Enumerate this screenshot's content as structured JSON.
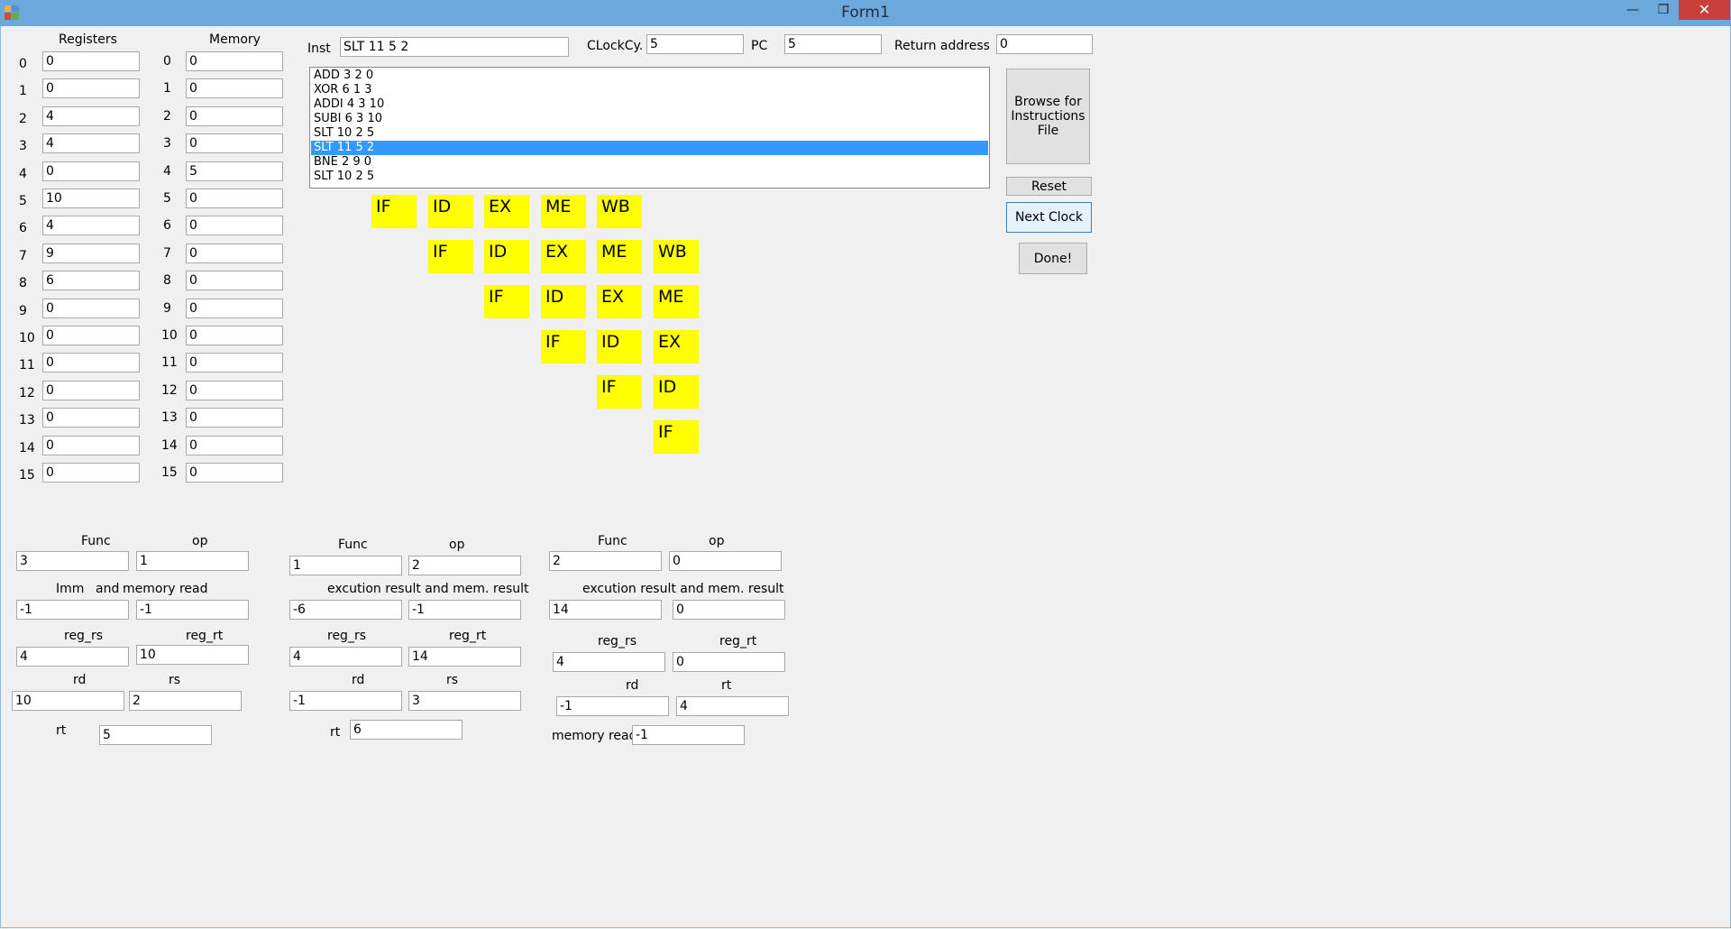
{
  "window": {
    "title": "Form1",
    "min": "—",
    "max": "❐",
    "close": "✕"
  },
  "registers": {
    "title": "Registers",
    "items": [
      {
        "label": "0",
        "value": "0"
      },
      {
        "label": "1",
        "value": "0"
      },
      {
        "label": "2",
        "value": "4"
      },
      {
        "label": "3",
        "value": "4"
      },
      {
        "label": "4",
        "value": "0"
      },
      {
        "label": "5",
        "value": "10"
      },
      {
        "label": "6",
        "value": "4"
      },
      {
        "label": "7",
        "value": "9"
      },
      {
        "label": "8",
        "value": "6"
      },
      {
        "label": "9",
        "value": "0"
      },
      {
        "label": "10",
        "value": "0"
      },
      {
        "label": "11",
        "value": "0"
      },
      {
        "label": "12",
        "value": "0"
      },
      {
        "label": "13",
        "value": "0"
      },
      {
        "label": "14",
        "value": "0"
      },
      {
        "label": "15",
        "value": "0"
      }
    ]
  },
  "memory": {
    "title": "Memory",
    "items": [
      {
        "label": "0",
        "value": "0"
      },
      {
        "label": "1",
        "value": "0"
      },
      {
        "label": "2",
        "value": "0"
      },
      {
        "label": "3",
        "value": "0"
      },
      {
        "label": "4",
        "value": "5"
      },
      {
        "label": "5",
        "value": "0"
      },
      {
        "label": "6",
        "value": "0"
      },
      {
        "label": "7",
        "value": "0"
      },
      {
        "label": "8",
        "value": "0"
      },
      {
        "label": "9",
        "value": "0"
      },
      {
        "label": "10",
        "value": "0"
      },
      {
        "label": "11",
        "value": "0"
      },
      {
        "label": "12",
        "value": "0"
      },
      {
        "label": "13",
        "value": "0"
      },
      {
        "label": "14",
        "value": "0"
      },
      {
        "label": "15",
        "value": "0"
      }
    ]
  },
  "top": {
    "inst_label": "Inst",
    "inst_value": "SLT 11 5 2",
    "clock_label": "CLockCy.",
    "clock_value": "5",
    "pc_label": "PC",
    "pc_value": "5",
    "return_label": "Return address",
    "return_value": "0"
  },
  "instructions": {
    "items": [
      "ADD 3 2 0",
      "XOR 6 1 3",
      "ADDI 4 3 10",
      "SUBI 6 3 10",
      "SLT 10 2 5",
      "SLT 11 5 2",
      "BNE 2 9 0",
      "SLT 10 2 5"
    ],
    "selected_index": 5
  },
  "buttons": {
    "browse": "Browse for Instructions File",
    "reset": "Reset",
    "next": "Next Clock",
    "done": "Done!"
  },
  "pipeline": {
    "rows": [
      {
        "start": 0,
        "stages": [
          "IF",
          "ID",
          "EX",
          "ME",
          "WB"
        ]
      },
      {
        "start": 1,
        "stages": [
          "IF",
          "ID",
          "EX",
          "ME",
          "WB"
        ]
      },
      {
        "start": 2,
        "stages": [
          "IF",
          "ID",
          "EX",
          "ME"
        ]
      },
      {
        "start": 3,
        "stages": [
          "IF",
          "ID",
          "EX"
        ]
      },
      {
        "start": 4,
        "stages": [
          "IF",
          "ID"
        ]
      },
      {
        "start": 5,
        "stages": [
          "IF"
        ]
      }
    ],
    "highlight_color": "#ffff00"
  },
  "panel1": {
    "func_label": "Func",
    "func": "3",
    "op_label": "op",
    "op": "1",
    "imm_label": "Imm",
    "and_label": "and",
    "memread_label": "memory read",
    "imm": "-1",
    "memread": "-1",
    "reg_rs_label": "reg_rs",
    "reg_rs": "4",
    "reg_rt_label": "reg_rt",
    "reg_rt": "10",
    "rd_label": "rd",
    "rd": "10",
    "rs_label": "rs",
    "rs": "2",
    "rt_label": "rt",
    "rt": "5"
  },
  "panel2": {
    "func_label": "Func",
    "func": "1",
    "op_label": "op",
    "op": "2",
    "exec_label": "excution result and mem. result",
    "exec": "-6",
    "memres": "-1",
    "reg_rs_label": "reg_rs",
    "reg_rs": "4",
    "reg_rt_label": "reg_rt",
    "reg_rt": "14",
    "rd_label": "rd",
    "rd": "-1",
    "rs_label": "rs",
    "rs": "3",
    "rt_label": "rt",
    "rt": "6"
  },
  "panel3": {
    "func_label": "Func",
    "func": "2",
    "op_label": "op",
    "op": "0",
    "exec_label": "excution result and mem. result",
    "exec": "14",
    "memres": "0",
    "reg_rs_label": "reg_rs",
    "reg_rs": "4",
    "reg_rt_label": "reg_rt",
    "reg_rt": "0",
    "rd_label": "rd",
    "rd": "-1",
    "rt_label": "rt",
    "rt": "4",
    "memread_label": "memory read",
    "memread": "-1"
  }
}
